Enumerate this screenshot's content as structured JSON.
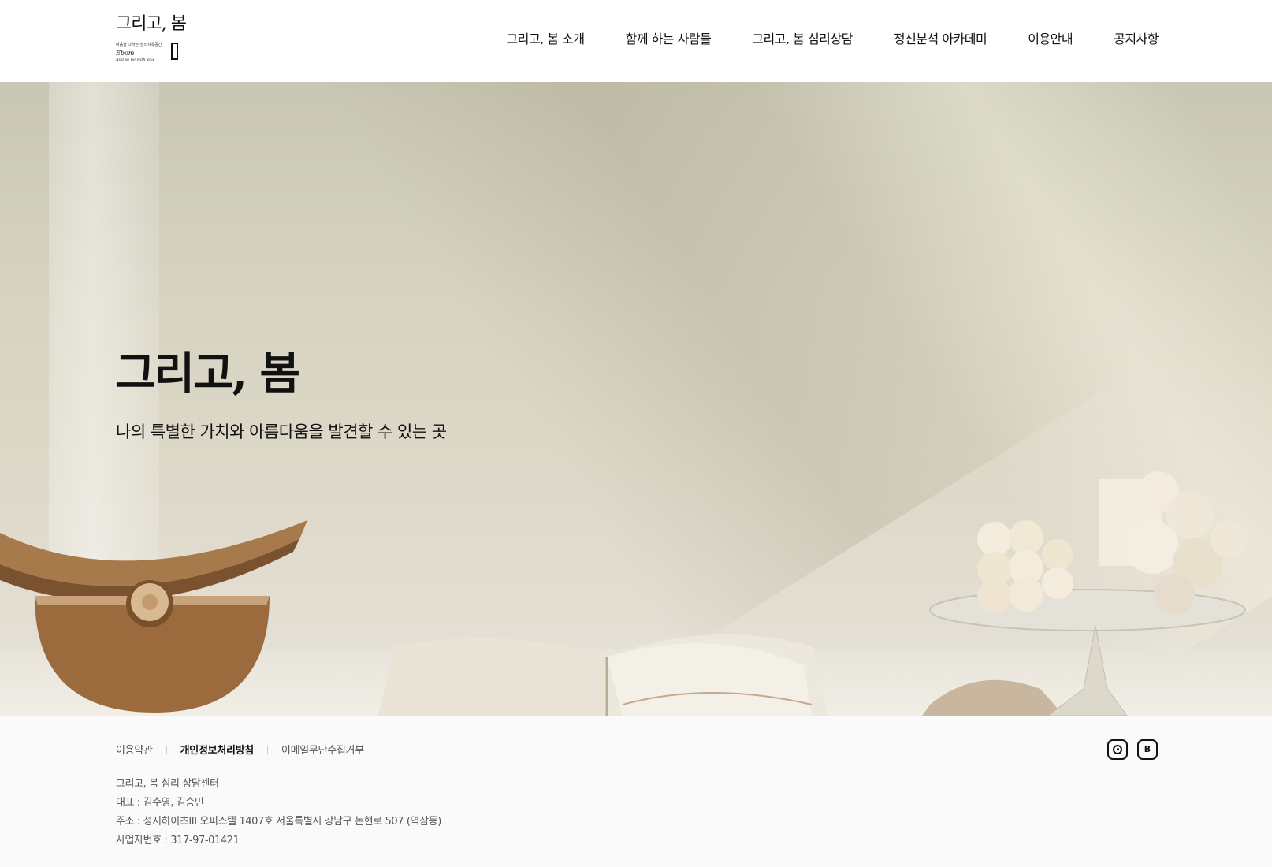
{
  "header": {
    "logo": {
      "main_text": "그리고, 봄",
      "small_text": "마음을 다하는 심리치유공간",
      "en_name": "Ebom",
      "tagline": "And so be with you"
    },
    "nav": [
      {
        "label": "그리고, 봄 소개"
      },
      {
        "label": "함께 하는 사람들"
      },
      {
        "label": "그리고, 봄 심리상담"
      },
      {
        "label": "정신분석 아카데미"
      },
      {
        "label": "이용안내"
      },
      {
        "label": "공지사항"
      }
    ]
  },
  "hero": {
    "title": "그리고, 봄",
    "subtitle": "나의 특별한 가치와 아름다움을 발견할 수 있는 곳"
  },
  "footer": {
    "links": {
      "terms": "이용약관",
      "privacy": "개인정보처리방침",
      "email_refusal": "이메일무단수집거부"
    },
    "info": {
      "company": "그리고, 봄 심리 상담센터",
      "ceo": "대표 : 김수영, 김승민",
      "address": "주소 : 성지하이츠III 오피스텔 1407호 서울특별시 강남구 논현로 507 (역삼동)",
      "business_no": "사업자번호 : 317-97-01421"
    },
    "social": {
      "instagram_icon": "instagram-icon",
      "blog_icon": "blog-icon",
      "blog_letter": "B"
    }
  },
  "colors": {
    "text": "#111111",
    "footer_bg": "#fafafa",
    "hero_wall": "#d7d3c2"
  }
}
